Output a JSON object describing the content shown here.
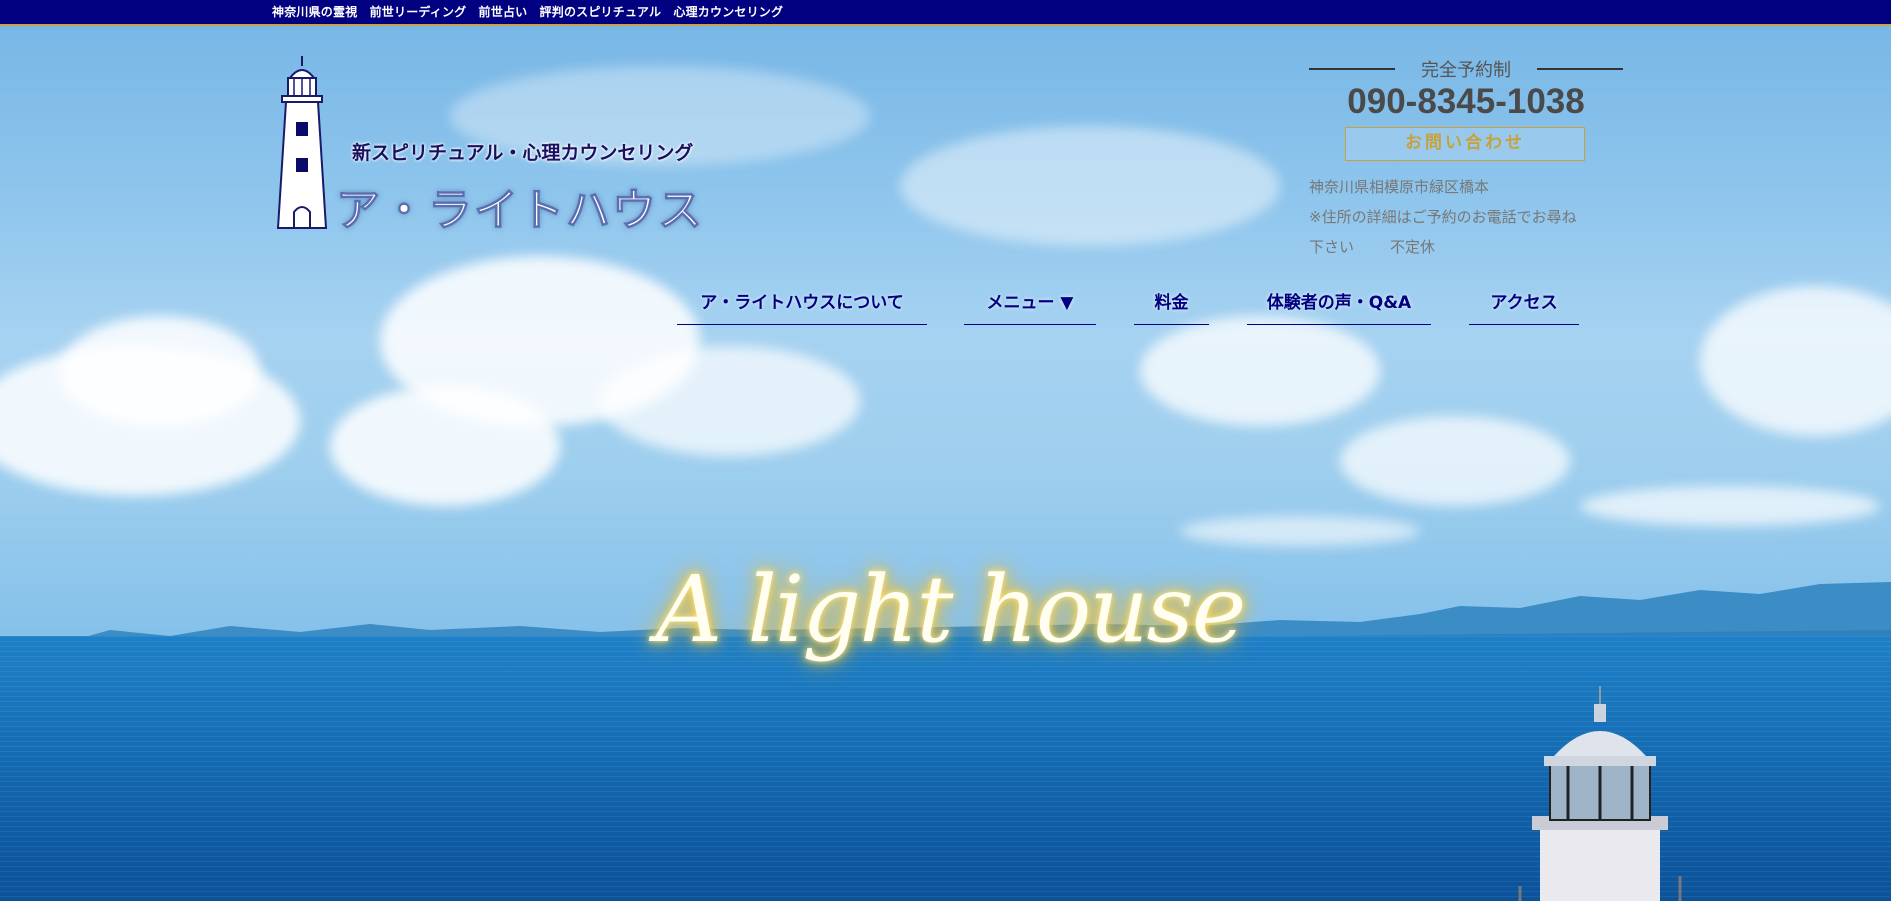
{
  "topbar": {
    "text": "神奈川県の霊視　前世リーディング　前世占い　評判のスピリチュアル　心理カウンセリング"
  },
  "logo": {
    "subtitle": "新スピリチュアル・心理カウンセリング",
    "name": "ア・ライトハウス",
    "icon": "lighthouse-icon"
  },
  "contact": {
    "reserve_label": "完全予約制",
    "phone": "090-8345-1038",
    "inquiry_label": "お問い合わせ",
    "address_line1": "神奈川県相模原市緑区橋本",
    "address_line2": "※住所の詳細はご予約のお電話でお尋ね",
    "address_line3": "下さい",
    "hours": "不定休"
  },
  "nav": {
    "items": [
      {
        "label": "ア・ライトハウスについて"
      },
      {
        "label": "メニュー ▼"
      },
      {
        "label": "料金"
      },
      {
        "label": "体験者の声・Q&A"
      },
      {
        "label": "アクセス"
      }
    ]
  },
  "hero": {
    "script_title": "A light house"
  },
  "colors": {
    "topbar": "#000080",
    "accent_gold": "#c9a13a",
    "nav": "#000080"
  }
}
